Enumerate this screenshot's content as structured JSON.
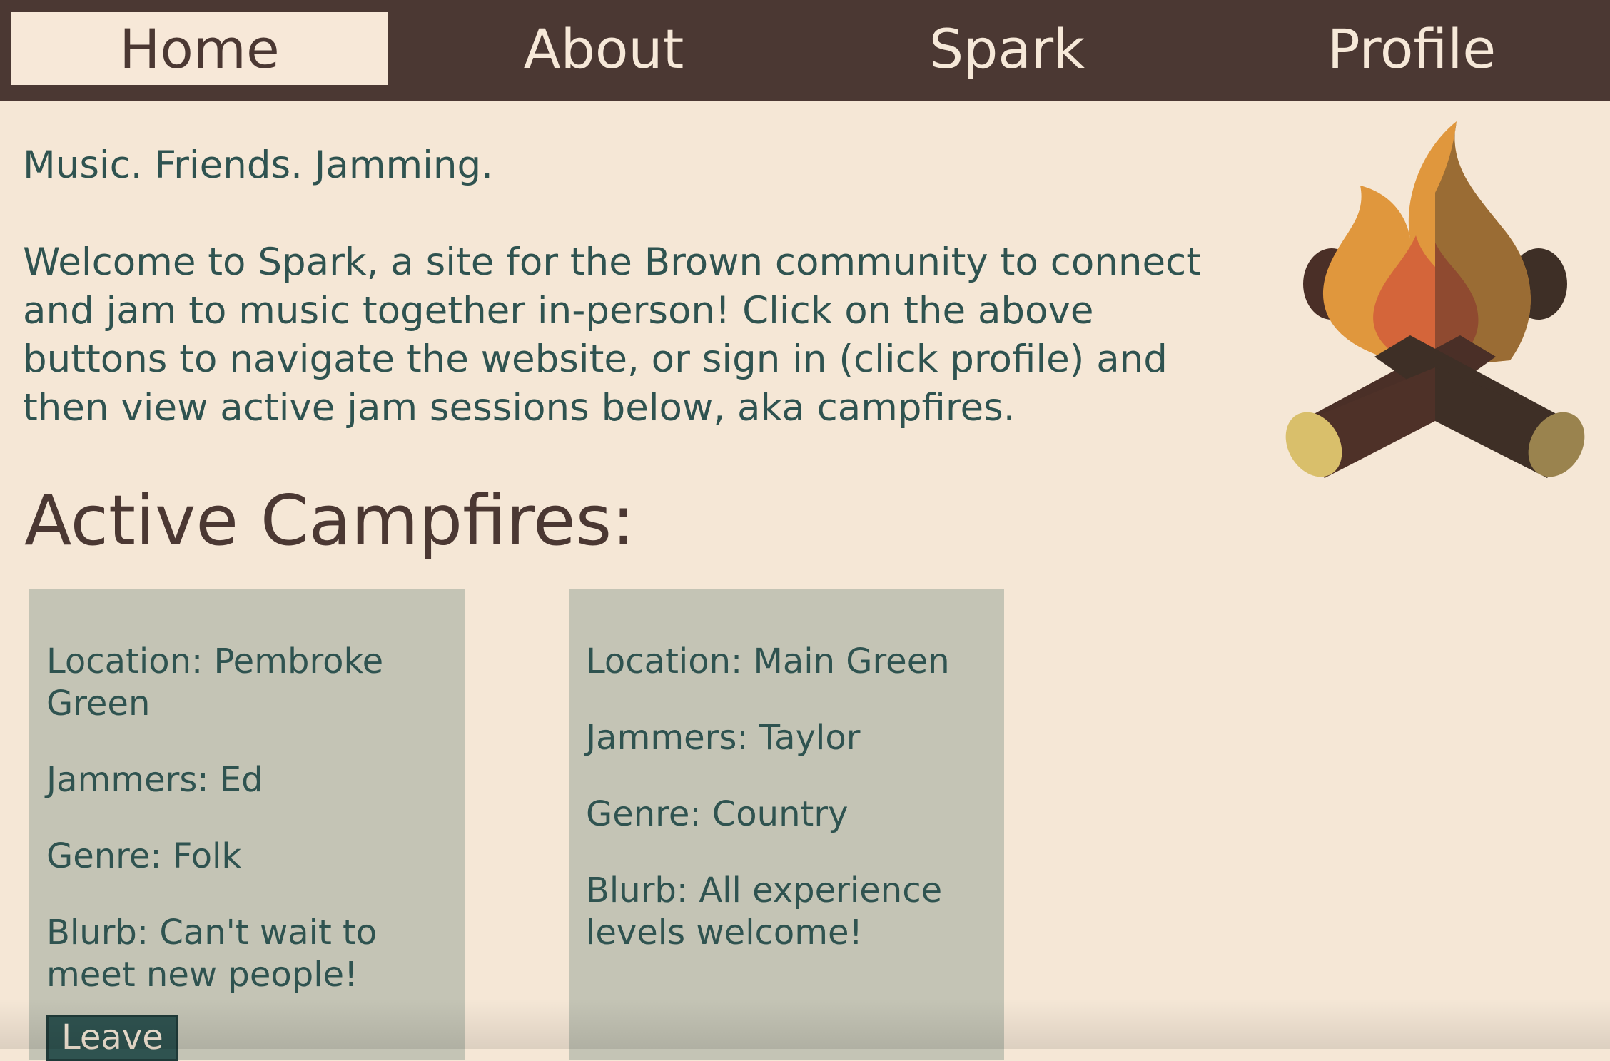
{
  "nav": {
    "home": "Home",
    "about": "About",
    "spark": "Spark",
    "profile": "Profile"
  },
  "intro": {
    "tagline": "Music. Friends. Jamming.",
    "welcome": "Welcome to Spark, a site for the Brown community to connect and jam to music together in-person! Click on the above buttons to navigate the website, or sign in (click profile) and then view active jam sessions below, aka campfires."
  },
  "campfires_title": "Active Campfires:",
  "campfires": [
    {
      "location": "Location: Pembroke Green",
      "jammers": "Jammers: Ed",
      "genre": "Genre: Folk",
      "blurb": "Blurb: Can't wait to meet new people!",
      "action": "Leave"
    },
    {
      "location": "Location: Main Green",
      "jammers": "Jammers: Taylor",
      "genre": "Genre: Country",
      "blurb": "Blurb: All experience levels welcome!"
    }
  ],
  "colors": {
    "nav_bg": "#4b3833",
    "page_bg": "#f5e7d6",
    "text": "#2f5350",
    "card_bg": "#c4c4b5"
  },
  "icons": {
    "logo": "campfire-icon"
  }
}
